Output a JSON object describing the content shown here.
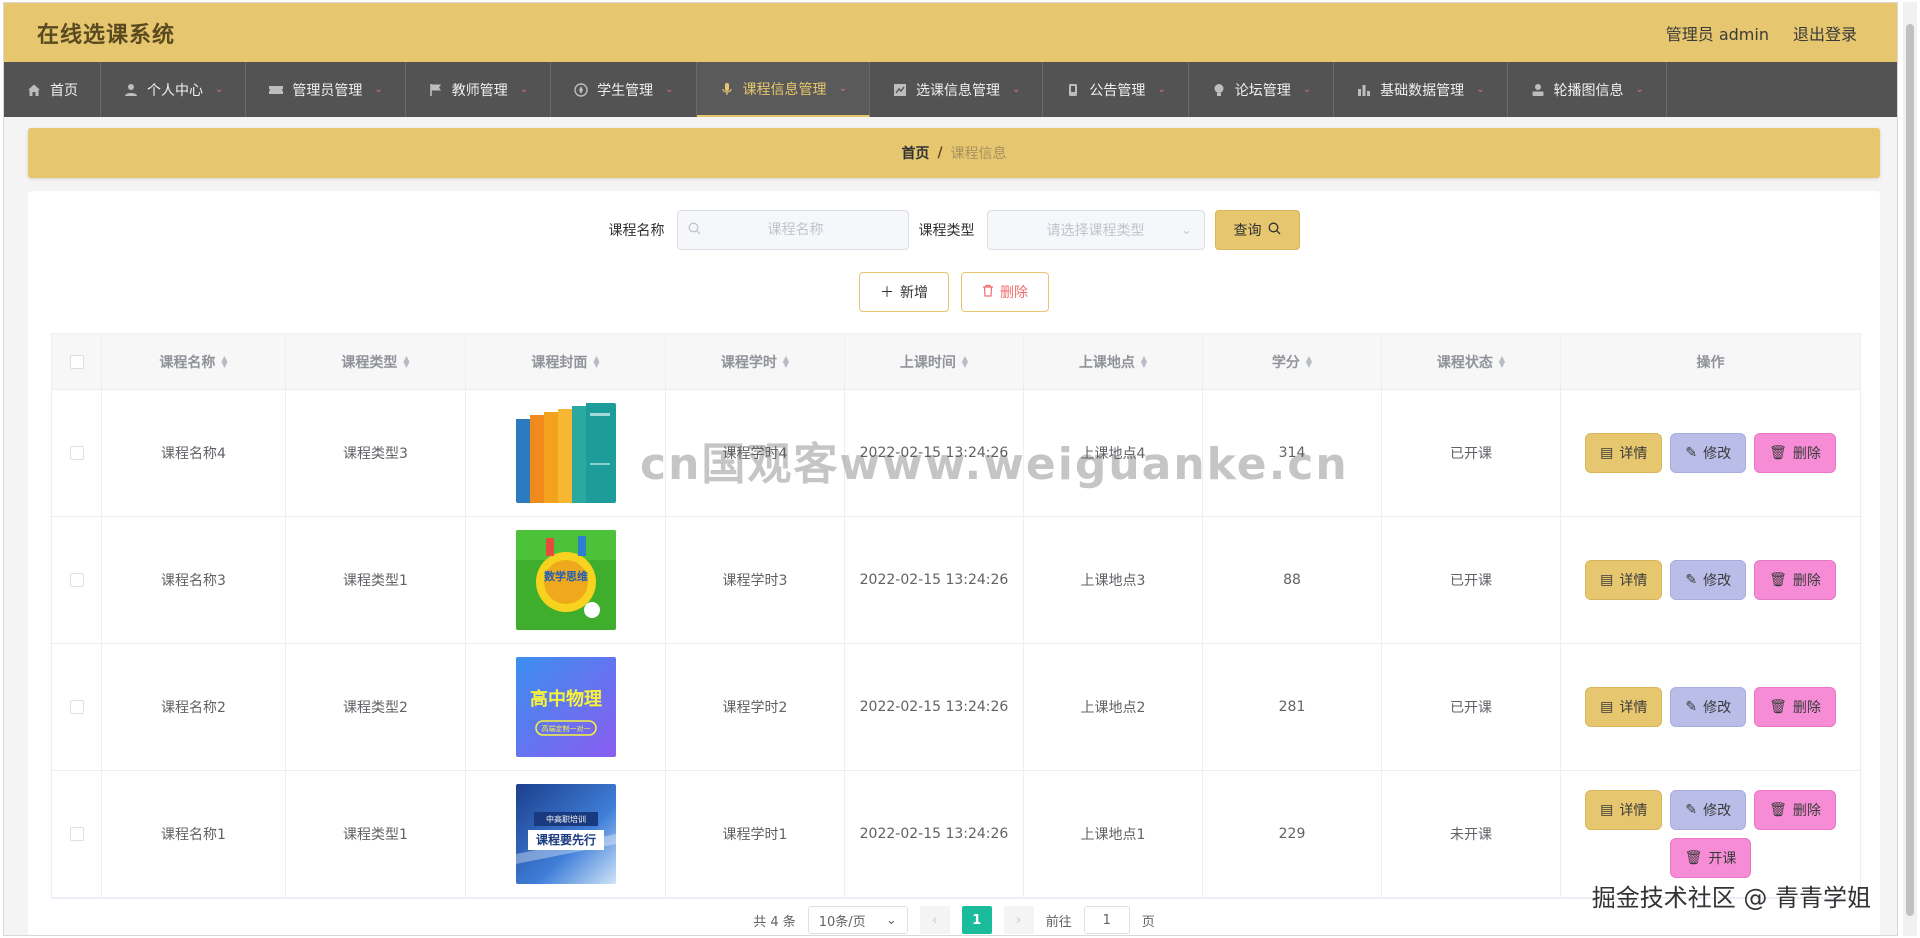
{
  "header": {
    "title": "在线选课系统",
    "user_label": "管理员 admin",
    "logout_label": "退出登录"
  },
  "nav": {
    "items": [
      {
        "label": "首页",
        "icon": "home-icon"
      },
      {
        "label": "个人中心",
        "icon": "user-icon"
      },
      {
        "label": "管理员管理",
        "icon": "ticket-icon"
      },
      {
        "label": "教师管理",
        "icon": "flag-icon"
      },
      {
        "label": "学生管理",
        "icon": "compass-icon"
      },
      {
        "label": "课程信息管理",
        "icon": "microphone-icon"
      },
      {
        "label": "选课信息管理",
        "icon": "chart-icon"
      },
      {
        "label": "公告管理",
        "icon": "phone-icon"
      },
      {
        "label": "论坛管理",
        "icon": "lightbulb-icon"
      },
      {
        "label": "基础数据管理",
        "icon": "bar-chart-icon"
      },
      {
        "label": "轮播图信息",
        "icon": "person-icon"
      }
    ],
    "active_index": 5
  },
  "breadcrumb": {
    "home": "首页",
    "separator": "/",
    "current": "课程信息"
  },
  "search": {
    "name_label": "课程名称",
    "name_placeholder": "课程名称",
    "type_label": "课程类型",
    "type_placeholder": "请选择课程类型",
    "query_label": "查询"
  },
  "actions": {
    "add_label": "新增",
    "delete_label": "删除"
  },
  "table": {
    "columns": [
      "课程名称",
      "课程类型",
      "课程封面",
      "课程学时",
      "上课时间",
      "上课地点",
      "学分",
      "课程状态",
      "操作"
    ],
    "rows": [
      {
        "name": "课程名称4",
        "type": "课程类型3",
        "cover": "books-cover",
        "hours": "课程学时4",
        "time": "2022-02-15 13:24:26",
        "place": "上课地点4",
        "credit": "314",
        "status": "已开课"
      },
      {
        "name": "课程名称3",
        "type": "课程类型1",
        "cover": "math-cover",
        "hours": "课程学时3",
        "time": "2022-02-15 13:24:26",
        "place": "上课地点3",
        "credit": "88",
        "status": "已开课"
      },
      {
        "name": "课程名称2",
        "type": "课程类型2",
        "cover": "physics-cover",
        "hours": "课程学时2",
        "time": "2022-02-15 13:24:26",
        "place": "上课地点2",
        "credit": "281",
        "status": "已开课"
      },
      {
        "name": "课程名称1",
        "type": "课程类型1",
        "cover": "course-cover",
        "hours": "课程学时1",
        "time": "2022-02-15 13:24:26",
        "place": "上课地点1",
        "credit": "229",
        "status": "未开课"
      }
    ],
    "op_labels": {
      "detail": "详情",
      "edit": "修改",
      "delete": "删除",
      "open": "开课"
    },
    "cover_texts": {
      "math": "数学思维",
      "physics_title": "高中物理",
      "physics_sub": "高端定制一对一",
      "course_top": "中高职培训",
      "course_main": "课程要先行"
    }
  },
  "pagination": {
    "total_label": "共 4 条",
    "page_size_label": "10条/页",
    "current_page": "1",
    "goto_label": "前往",
    "goto_value": "1",
    "page_suffix": "页"
  },
  "overlays": {
    "watermark": "cn国观客www.weiguanke.cn",
    "corner_mark": "掘金技术社区 @ 青青学姐"
  },
  "colors": {
    "accent": "#e6c66e",
    "nav_bg": "#535353",
    "edit_button": "#b9bde8",
    "delete_button": "#f58cd5",
    "active_page": "#1bbc9b"
  }
}
